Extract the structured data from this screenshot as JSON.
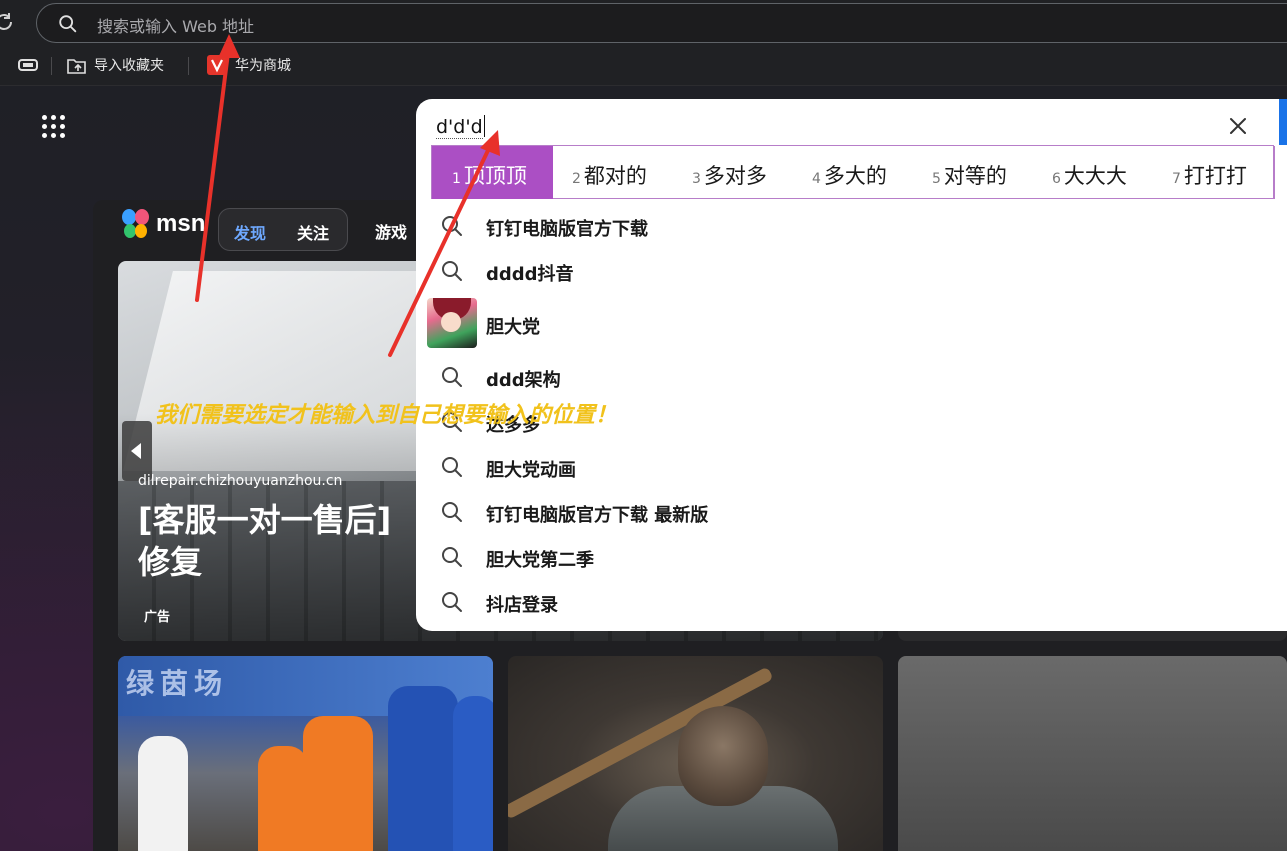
{
  "browser": {
    "address_placeholder": "搜索或输入 Web 地址",
    "favorites": [
      {
        "label": "导入收藏夹"
      },
      {
        "label": "华为商城"
      }
    ]
  },
  "msn": {
    "logo_text": "msn",
    "tabs": [
      {
        "label": "发现",
        "active": true
      },
      {
        "label": "关注",
        "active": false
      }
    ],
    "nav": [
      {
        "label": "游戏"
      }
    ],
    "hero": {
      "domain": "dilrepair.chizhouyuanzhou.cn",
      "title": "[客服一对一售后]修复",
      "ad_label": "广告"
    },
    "card_banner_text": "绿茵场"
  },
  "search": {
    "query_text": "d'd'd",
    "ime_candidates": [
      {
        "num": "1",
        "text": "顶顶顶",
        "selected": true
      },
      {
        "num": "2",
        "text": "都对的"
      },
      {
        "num": "3",
        "text": "多对多"
      },
      {
        "num": "4",
        "text": "多大的"
      },
      {
        "num": "5",
        "text": "对等的"
      },
      {
        "num": "6",
        "text": "大大大"
      },
      {
        "num": "7",
        "text": "打打打"
      }
    ],
    "suggestions": [
      {
        "text": "钉钉电脑版官方下载",
        "icon": "search-icon"
      },
      {
        "text": "dddd抖音",
        "icon": "search-icon"
      },
      {
        "text": "胆大党",
        "icon": "thumbnail"
      },
      {
        "text": "ddd架构",
        "icon": "search-icon"
      },
      {
        "text": "达多多",
        "icon": "search-icon"
      },
      {
        "text": "胆大党动画",
        "icon": "search-icon"
      },
      {
        "text": "钉钉电脑版官方下载 最新版",
        "icon": "search-icon"
      },
      {
        "text": "胆大党第二季",
        "icon": "search-icon"
      },
      {
        "text": "抖店登录",
        "icon": "search-icon"
      }
    ]
  },
  "annotation": {
    "text": "我们需要选定才能输入到自己想要输入的位置！",
    "color": "#f1c21c",
    "arrow_color": "#e8312a"
  },
  "colors": {
    "ime_selected": "#ab4fc4",
    "accent_blue": "#1a73e8",
    "tab_active": "#6ea8fe"
  }
}
